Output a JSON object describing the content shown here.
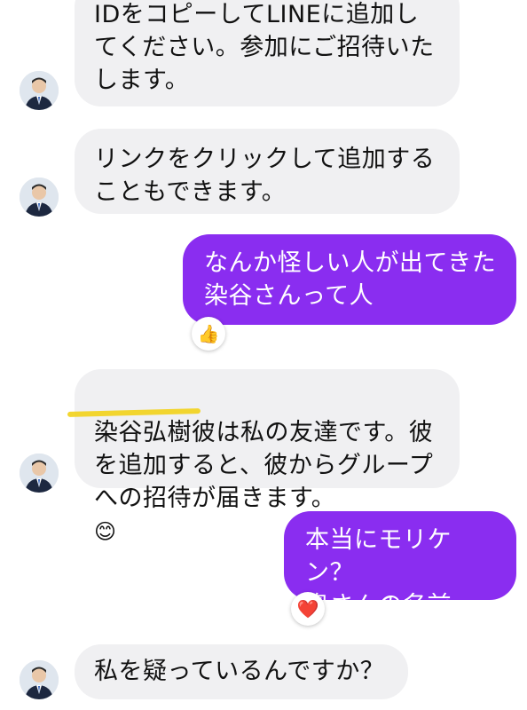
{
  "messages": [
    {
      "id": "m1",
      "side": "incoming",
      "text": "IDをコピーしてLINEに追加し\nてください。参加にご招待いた\nします。"
    },
    {
      "id": "m2",
      "side": "incoming",
      "text": "リンクをクリックして追加する\nこともできます。"
    },
    {
      "id": "m3",
      "side": "outgoing",
      "text": "なんか怪しい人が出てきた\n染谷さんって人",
      "reaction": "👍"
    },
    {
      "id": "m4",
      "side": "incoming",
      "text": "染谷弘樹彼は私の友達です。彼\nを追加すると、彼からグループ\nへの招待が届きます。",
      "emoji": "😊",
      "highlighted_text": "染谷弘樹"
    },
    {
      "id": "m5",
      "side": "outgoing",
      "text": "本当にモリケン？\n奥さんの名前は？",
      "reaction": "❤️"
    },
    {
      "id": "m6",
      "side": "incoming",
      "text": "私を疑っているんですか？"
    }
  ],
  "colors": {
    "incoming_bubble": "#f0f0f2",
    "outgoing_bubble": "#8a2df0",
    "highlight": "#f2d21a"
  },
  "icons": {
    "avatar": "person-avatar-icon",
    "thumbs_up": "thumbs-up-reaction-icon",
    "heart": "heart-reaction-icon",
    "smile": "smiling-face-emoji"
  }
}
